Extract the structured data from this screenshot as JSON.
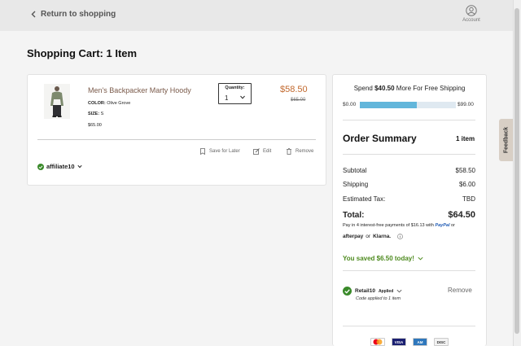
{
  "header": {
    "back_label": "Return to shopping",
    "account_label": "Account"
  },
  "page": {
    "title": "Shopping Cart: 1 Item"
  },
  "cart_item": {
    "name": "Men's Backpacker Marty Hoody",
    "color_label": "COLOR:",
    "color_value": "Olive Grove",
    "size_label": "SIZE:",
    "size_value": "S",
    "unit_price": "$65.00",
    "quantity_label": "Quantity:",
    "quantity_value": "1",
    "price": "$58.50",
    "original_price": "$65.00",
    "actions": {
      "save_for_later": "Save for Later",
      "edit": "Edit",
      "remove": "Remove"
    }
  },
  "affiliate": {
    "code": "affiliate10"
  },
  "shipping_progress": {
    "text_prefix": "Spend",
    "amount": "$40.50",
    "text_suffix": "More For Free Shipping",
    "min_label": "$0.00",
    "max_label": "$99.00",
    "fraction": 0.59
  },
  "summary": {
    "title": "Order Summary",
    "item_count": "1 item",
    "rows": [
      {
        "label": "Subtotal",
        "value": "$58.50"
      },
      {
        "label": "Shipping",
        "value": "$6.00"
      },
      {
        "label": "Estimated Tax:",
        "value": "TBD"
      }
    ],
    "total_label": "Total:",
    "total_value": "$64.50",
    "installments_text": "Pay in 4 interest-free payments of $16.13 with",
    "paypal_label": "PayPal",
    "or_label": "or",
    "afterpay_label": "afterpay",
    "or_label2": "or",
    "klarna_label": "Klarna."
  },
  "savings": {
    "text": "You saved $6.50 today!"
  },
  "promo": {
    "code": "Retail10",
    "applied_label": "Applied",
    "sub_text": "Code applied to 1 item",
    "remove_label": "Remove"
  },
  "payment_cards": [
    {
      "name": "mastercard",
      "label": "",
      "color": "#ffffff"
    },
    {
      "name": "visa",
      "label": "VISA",
      "color": "#1a1f71"
    },
    {
      "name": "amex",
      "label": "AM",
      "color": "#2e77bc"
    },
    {
      "name": "discover",
      "label": "DISC",
      "color": "#f2f2f2"
    }
  ],
  "feedback": {
    "label": "Feedback"
  },
  "colors": {
    "price": "#c2692e",
    "saved": "#4d8a1e",
    "progress": "#62b6db",
    "check": "#3a8a2a"
  }
}
